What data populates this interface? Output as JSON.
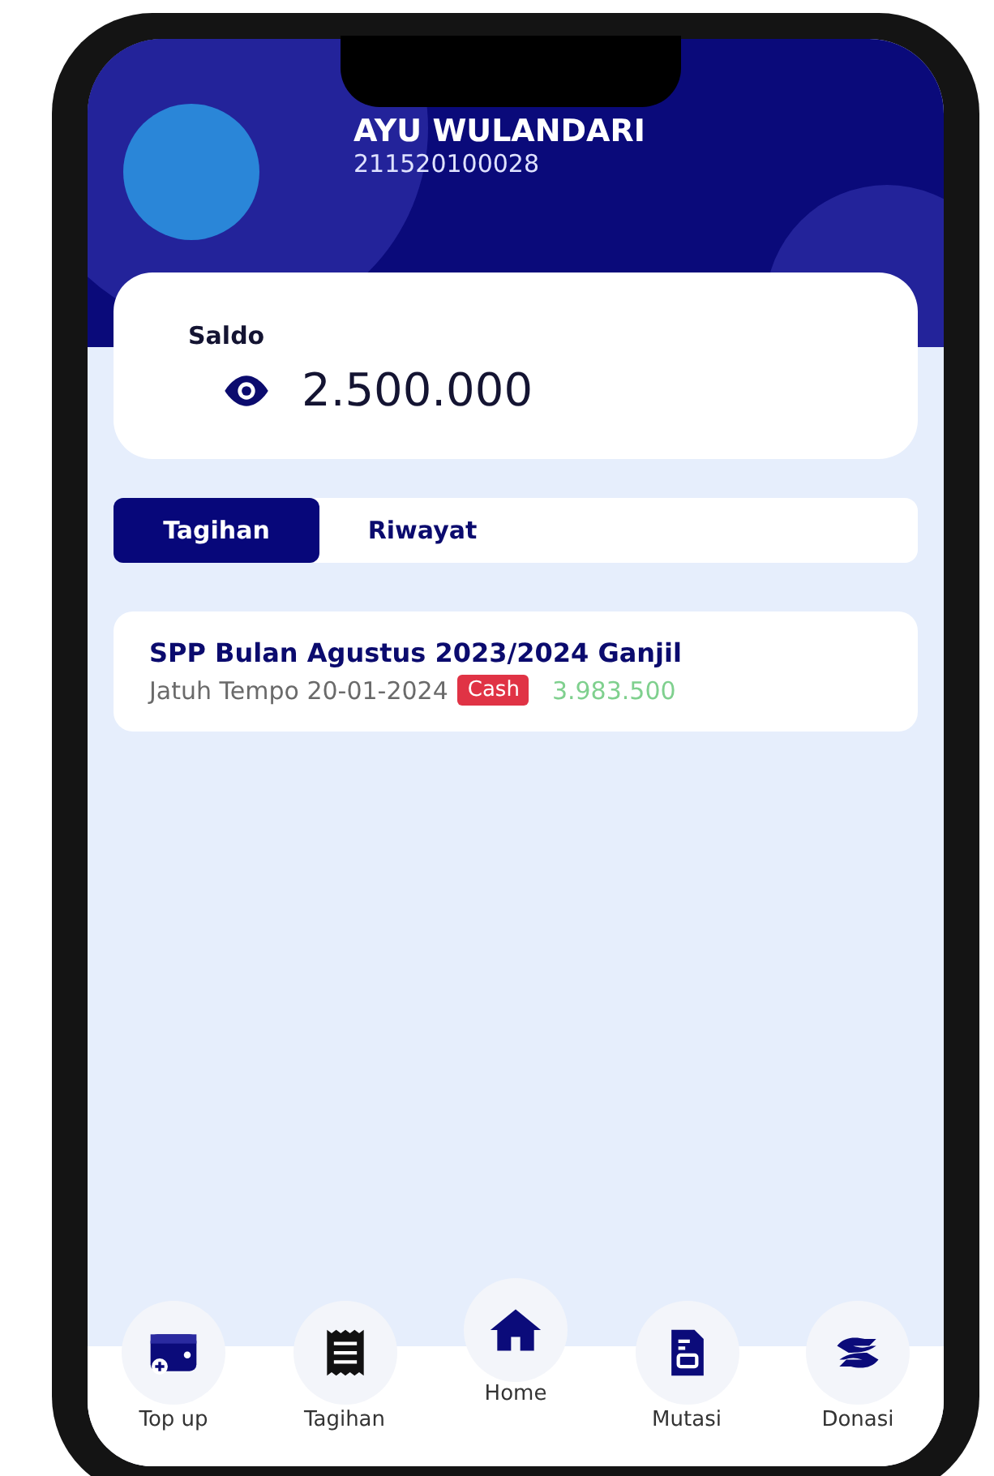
{
  "profile": {
    "name": "AYU WULANDARI",
    "id_number": "211520100028"
  },
  "balance": {
    "label": "Saldo",
    "amount": "2.500.000"
  },
  "tabs": [
    {
      "label": "Tagihan",
      "selected": true
    },
    {
      "label": "Riwayat",
      "selected": false
    }
  ],
  "bills": [
    {
      "title": "SPP Bulan Agustus 2023/2024 Ganjil",
      "due": "Jatuh Tempo 20-01-2024",
      "method": "Cash",
      "amount": "3.983.500"
    }
  ],
  "bottom_nav": [
    {
      "label": "Top up",
      "selected": false
    },
    {
      "label": "Tagihan",
      "selected": false
    },
    {
      "label": "Home",
      "selected": true
    },
    {
      "label": "Mutasi",
      "selected": false
    },
    {
      "label": "Donasi",
      "selected": false
    }
  ]
}
